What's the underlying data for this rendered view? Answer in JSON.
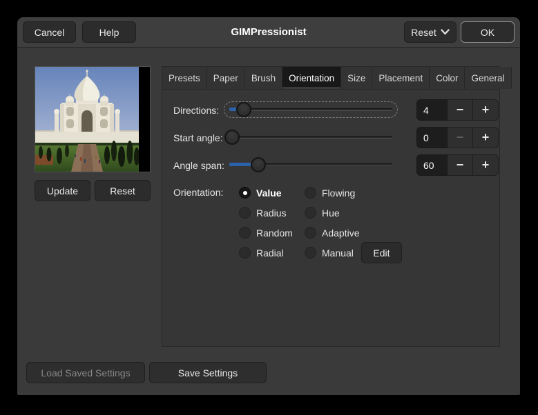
{
  "window": {
    "title": "GIMPressionist"
  },
  "header": {
    "cancel_label": "Cancel",
    "help_label": "Help",
    "reset_menu_label": "Reset",
    "ok_label": "OK"
  },
  "preview": {
    "description": "photo preview of the Taj Mahal",
    "update_label": "Update",
    "reset_label": "Reset"
  },
  "tabs": [
    {
      "label": "Presets",
      "active": false
    },
    {
      "label": "Paper",
      "active": false
    },
    {
      "label": "Brush",
      "active": false
    },
    {
      "label": "Orientation",
      "active": true
    },
    {
      "label": "Size",
      "active": false
    },
    {
      "label": "Placement",
      "active": false
    },
    {
      "label": "Color",
      "active": false
    },
    {
      "label": "General",
      "active": false
    }
  ],
  "panel": {
    "sliders": [
      {
        "label": "Directions:",
        "value": "4",
        "fill_pct": 7.5,
        "focused": true,
        "minus_enabled": true
      },
      {
        "label": "Start angle:",
        "value": "0",
        "fill_pct": 0,
        "focused": false,
        "minus_enabled": false
      },
      {
        "label": "Angle span:",
        "value": "60",
        "fill_pct": 16.5,
        "focused": false,
        "minus_enabled": true
      }
    ],
    "orientation_label": "Orientation:",
    "radios": [
      {
        "label": "Value",
        "selected": true
      },
      {
        "label": "Flowing",
        "selected": false
      },
      {
        "label": "Radius",
        "selected": false
      },
      {
        "label": "Hue",
        "selected": false
      },
      {
        "label": "Random",
        "selected": false
      },
      {
        "label": "Adaptive",
        "selected": false
      },
      {
        "label": "Radial",
        "selected": false
      },
      {
        "label": "Manual",
        "selected": false
      }
    ],
    "edit_label": "Edit"
  },
  "footer": {
    "load_label": "Load Saved Settings",
    "load_enabled": false,
    "save_label": "Save Settings"
  },
  "icons": {
    "minus": "−",
    "plus": "+"
  },
  "colors": {
    "accent_blue": "#2b62aa",
    "window_bg": "#3a3a3a",
    "header_bg": "#3e3e3e",
    "active_tab_bg": "#181818"
  }
}
